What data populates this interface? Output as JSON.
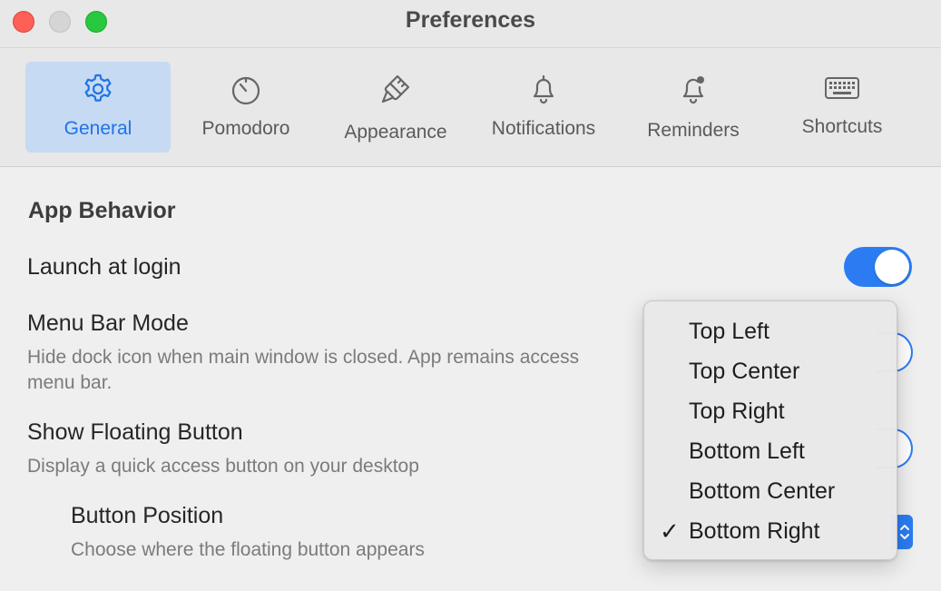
{
  "window": {
    "title": "Preferences"
  },
  "toolbar": {
    "tabs": [
      {
        "label": "General",
        "icon": "gear-icon",
        "selected": true
      },
      {
        "label": "Pomodoro",
        "icon": "timer-icon",
        "selected": false
      },
      {
        "label": "Appearance",
        "icon": "paintbrush-icon",
        "selected": false
      },
      {
        "label": "Notifications",
        "icon": "bell-icon",
        "selected": false
      },
      {
        "label": "Reminders",
        "icon": "bell-badge-icon",
        "selected": false
      },
      {
        "label": "Shortcuts",
        "icon": "keyboard-icon",
        "selected": false
      }
    ]
  },
  "content": {
    "section_heading": "App Behavior",
    "launch_at_login": {
      "title": "Launch at login",
      "enabled": true
    },
    "menu_bar_mode": {
      "title": "Menu Bar Mode",
      "description_line1": "Hide dock icon when main window is closed. App remains access",
      "description_line2": "menu bar."
    },
    "floating_button": {
      "title": "Show Floating Button",
      "description": "Display a quick access button on your desktop"
    },
    "button_position": {
      "title": "Button Position",
      "description": "Choose where the floating button appears",
      "selected": "Bottom Right"
    }
  },
  "position_menu": {
    "items": [
      {
        "label": "Top Left",
        "checked": false
      },
      {
        "label": "Top Center",
        "checked": false
      },
      {
        "label": "Top Right",
        "checked": false
      },
      {
        "label": "Bottom Left",
        "checked": false
      },
      {
        "label": "Bottom Center",
        "checked": false
      },
      {
        "label": "Bottom Right",
        "checked": true
      }
    ],
    "check_glyph": "✓"
  },
  "colors": {
    "accent": "#2b7cf2",
    "selected_tab_bg": "#c6daf3",
    "selected_tab_text": "#1f73e6",
    "close": "#fe5f57",
    "maximize": "#28c840"
  }
}
